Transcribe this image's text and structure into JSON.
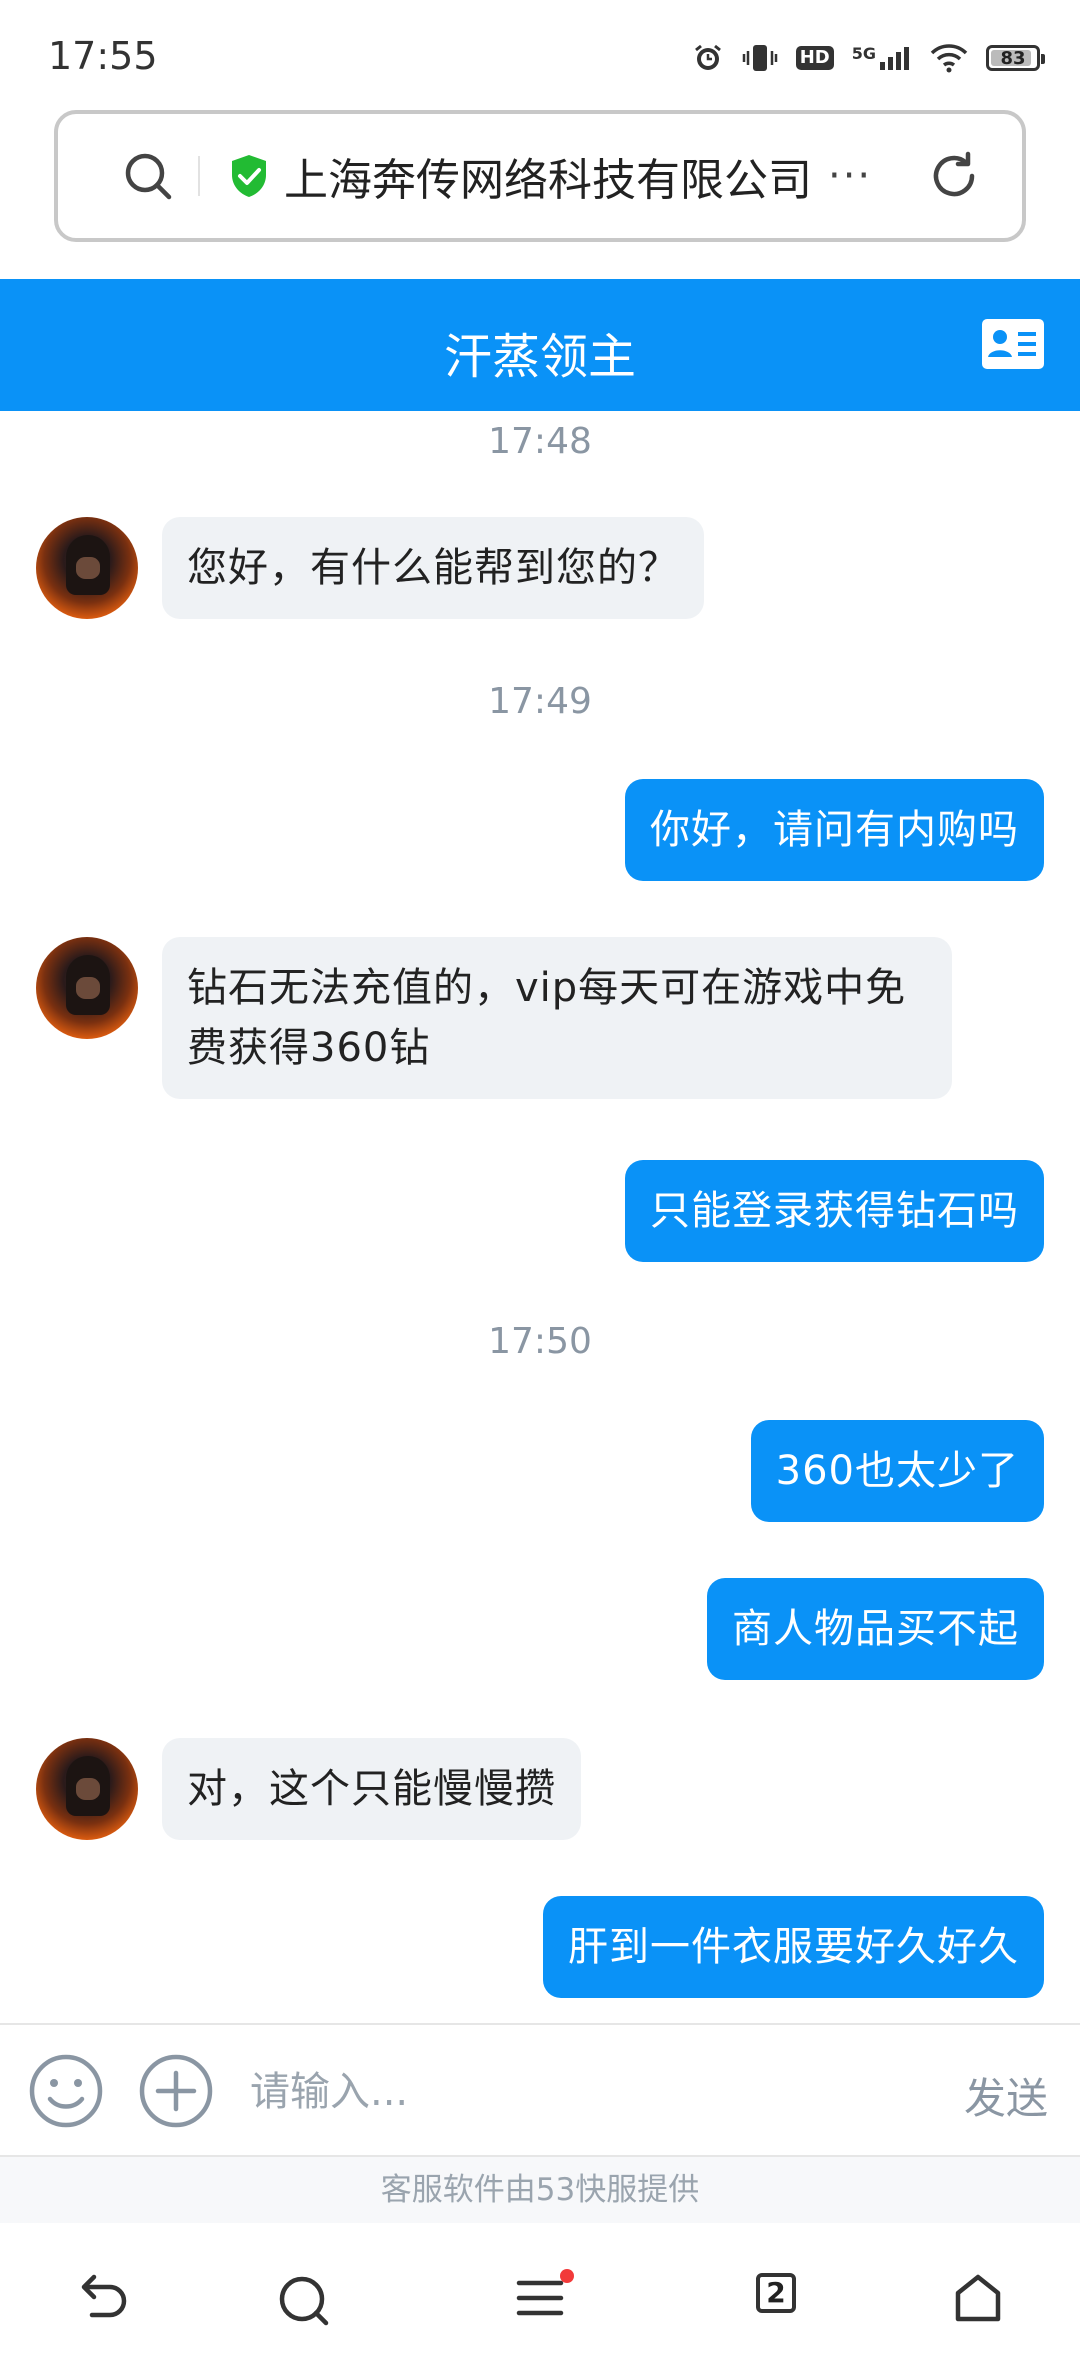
{
  "status_bar": {
    "time": "17:55",
    "hd_label": "HD",
    "network_label": "5G",
    "battery_level": "83",
    "icons": [
      "alarm-icon",
      "vibrate-icon",
      "hd-icon",
      "signal-5g-icon",
      "wifi-icon",
      "battery-icon"
    ]
  },
  "address_bar": {
    "site_name": "上海奔传网络科技有限公司",
    "more": "···",
    "shield_color": "#22bb33"
  },
  "chat_header": {
    "title": "汗蒸领主",
    "color": "#0a92f7"
  },
  "messages": [
    {
      "type": "time",
      "text": "17:48"
    },
    {
      "type": "left",
      "text": "您好，有什么能帮到您的？"
    },
    {
      "type": "time",
      "text": "17:49"
    },
    {
      "type": "right",
      "text": "你好，请问有内购吗"
    },
    {
      "type": "left",
      "text": "钻石无法充值的，vip每天可在游戏中免费获得360钻"
    },
    {
      "type": "right",
      "text": "只能登录获得钻石吗"
    },
    {
      "type": "time",
      "text": "17:50"
    },
    {
      "type": "right",
      "text": "360也太少了"
    },
    {
      "type": "right",
      "text": "商人物品买不起"
    },
    {
      "type": "left",
      "text": "对，这个只能慢慢攒"
    },
    {
      "type": "right",
      "text": "肝到一件衣服要好久好久"
    }
  ],
  "input_bar": {
    "placeholder": "请输入...",
    "send_label": "发送"
  },
  "footer": {
    "powered_by": "客服软件由53快服提供"
  },
  "nav_bar": {
    "tab_count": "2",
    "notification_dot_color": "#f23a3a"
  }
}
